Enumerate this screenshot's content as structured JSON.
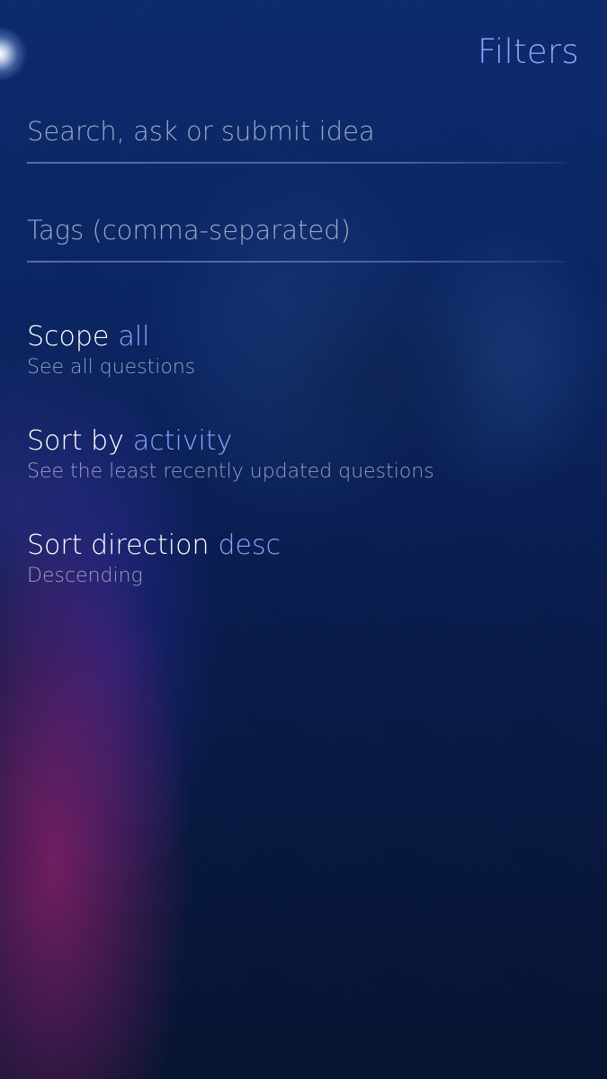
{
  "header": {
    "title": "Filters"
  },
  "search": {
    "placeholder": "Search, ask or submit idea",
    "value": ""
  },
  "tags": {
    "placeholder": "Tags (comma-separated)",
    "value": ""
  },
  "scope": {
    "label": "Scope",
    "value": "all",
    "description": "See all questions"
  },
  "sort_by": {
    "label": "Sort by",
    "value": "activity",
    "description": "See the least recently updated questions"
  },
  "sort_direction": {
    "label": "Sort direction",
    "value": "desc",
    "description": "Descending"
  },
  "colors": {
    "accent": "#8aa4ff",
    "primary_text": "#ffffff",
    "secondary_text": "#c8cde1"
  }
}
